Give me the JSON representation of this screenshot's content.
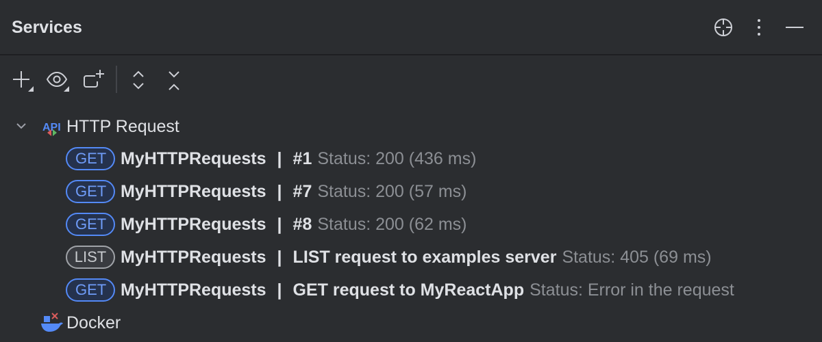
{
  "header": {
    "title": "Services"
  },
  "tree": {
    "groups": [
      {
        "label": "HTTP Request"
      },
      {
        "label": "Docker"
      }
    ],
    "requests": [
      {
        "method": "GET",
        "name": "MyHTTPRequests",
        "separator": "|",
        "label": "#1",
        "status": "Status: 200 (436 ms)"
      },
      {
        "method": "GET",
        "name": "MyHTTPRequests",
        "separator": "|",
        "label": "#7",
        "status": "Status: 200 (57 ms)"
      },
      {
        "method": "GET",
        "name": "MyHTTPRequests",
        "separator": "|",
        "label": "#8",
        "status": "Status: 200 (62 ms)"
      },
      {
        "method": "LIST",
        "name": "MyHTTPRequests",
        "separator": "|",
        "label": "LIST request to examples server",
        "status": "Status: 405 (69 ms)"
      },
      {
        "method": "GET",
        "name": "MyHTTPRequests",
        "separator": "|",
        "label": "GET request to MyReactApp",
        "status": "Status: Error in the request"
      }
    ]
  },
  "colors": {
    "bg": "#2b2d30",
    "get": "#548af7",
    "list": "#a0a3a8"
  }
}
